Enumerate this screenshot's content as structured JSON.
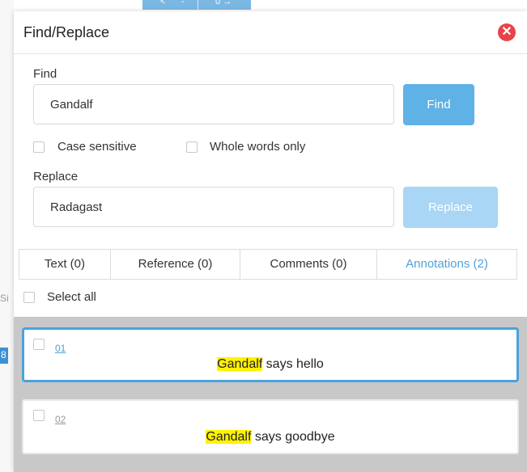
{
  "dialog": {
    "title": "Find/Replace"
  },
  "find": {
    "label": "Find",
    "value": "Gandalf",
    "button": "Find"
  },
  "options": {
    "case_sensitive": "Case sensitive",
    "whole_words": "Whole words only"
  },
  "replace": {
    "label": "Replace",
    "value": "Radagast",
    "button": "Replace"
  },
  "tabs": [
    {
      "label": "Text (0)",
      "active": false
    },
    {
      "label": "Reference (0)",
      "active": false
    },
    {
      "label": "Comments (0)",
      "active": false
    },
    {
      "label": "Annotations (2)",
      "active": true
    }
  ],
  "select_all": "Select all",
  "results": [
    {
      "number": "01",
      "match": "Gandalf",
      "rest": " says hello",
      "selected": true
    },
    {
      "number": "02",
      "match": "Gandalf",
      "rest": " says goodbye",
      "selected": false
    }
  ],
  "background": {
    "top_prev": "<",
    "top_dash": "-",
    "top_next": "0 →",
    "left_mark": "Si",
    "left_mark2": "8"
  },
  "colors": {
    "accent": "#5eb2e6",
    "accent_disabled": "#a9d6f4",
    "close": "#e6434b",
    "highlight": "#fff200",
    "results_bg": "#c8c8c8"
  }
}
